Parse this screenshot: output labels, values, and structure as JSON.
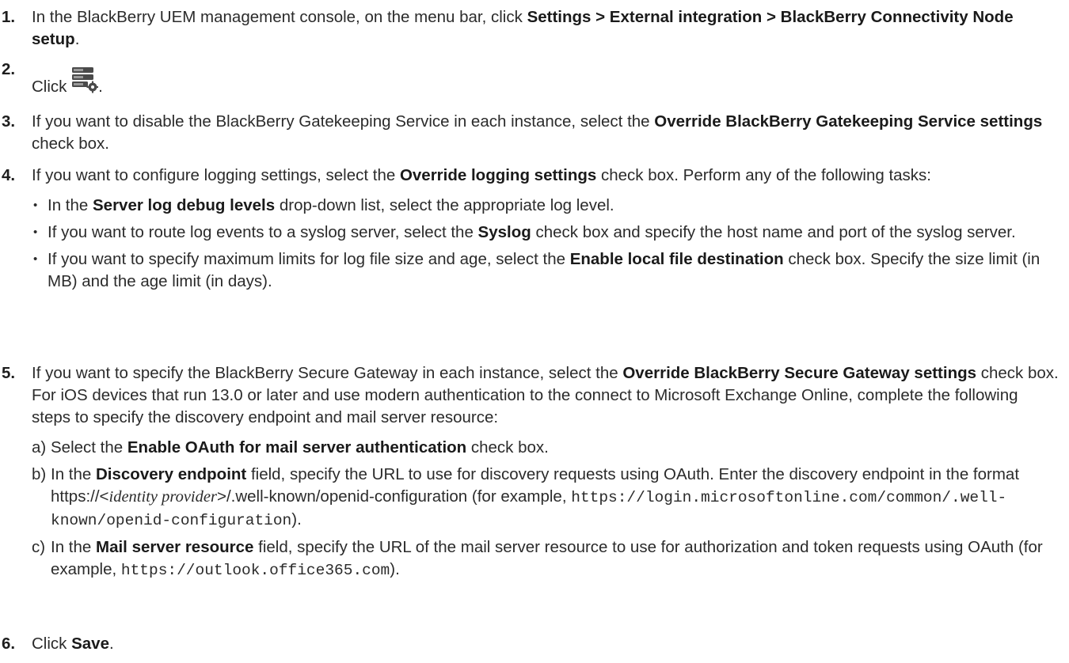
{
  "steps": [
    {
      "num": "1.",
      "t1": "In the BlackBerry UEM management console, on the menu bar, click ",
      "b1": "Settings > External integration > BlackBerry Connectivity Node setup",
      "t2": "."
    },
    {
      "num": "2.",
      "t1": "Click ",
      "icon": "server-settings-icon",
      "t2": "."
    },
    {
      "num": "3.",
      "t1": "If you want to disable the BlackBerry Gatekeeping Service in each instance, select the ",
      "b1": "Override BlackBerry Gatekeeping Service settings",
      "t2": " check box."
    },
    {
      "num": "4.",
      "t1": "If you want to configure logging settings, select the ",
      "b1": "Override logging settings",
      "t2": " check box. Perform any of the following tasks:",
      "bullets": [
        {
          "t1": "In the ",
          "b1": "Server log debug levels",
          "t2": " drop-down list, select the appropriate log level."
        },
        {
          "t1": "If you want to route log events to a syslog server, select the ",
          "b1": "Syslog",
          "t2": " check box and specify the host name and port of the syslog server."
        },
        {
          "t1": "If you want to specify maximum limits for log file size and age, select the ",
          "b1": "Enable local file destination",
          "t2": " check box. Specify the size limit (in MB) and the age limit (in days)."
        }
      ]
    },
    {
      "num": "5.",
      "t1": "If you want to specify the BlackBerry Secure Gateway in each instance, select the ",
      "b1": "Override BlackBerry Secure Gateway settings",
      "t2": " check box. For iOS devices that run 13.0 or later and use modern authentication to the connect to Microsoft Exchange Online, complete the following steps to specify the discovery endpoint and mail server resource:",
      "substeps": [
        {
          "letter": "a)",
          "t1": "Select the ",
          "b1": "Enable OAuth for mail server authentication",
          "t2": " check box."
        },
        {
          "letter": "b)",
          "t1": "In the ",
          "b1": "Discovery endpoint",
          "t2": " field, specify the URL to use for discovery requests using OAuth.  Enter the discovery endpoint in the format https://<",
          "italic": "identity provider",
          "t3": ">/.well-known/openid-configuration (for example, ",
          "code": "https://login.microsoftonline.com/common/.well-known/openid-configuration",
          "t4": ")."
        },
        {
          "letter": "c)",
          "t1": "In the ",
          "b1": "Mail server resource",
          "t2": " field, specify the URL of the mail server resource to use for authorization and token requests using OAuth (for example, ",
          "code": "https://outlook.office365.com",
          "t3": ")."
        }
      ]
    },
    {
      "num": "6.",
      "t1": "Click ",
      "b1": "Save",
      "t2": "."
    }
  ]
}
